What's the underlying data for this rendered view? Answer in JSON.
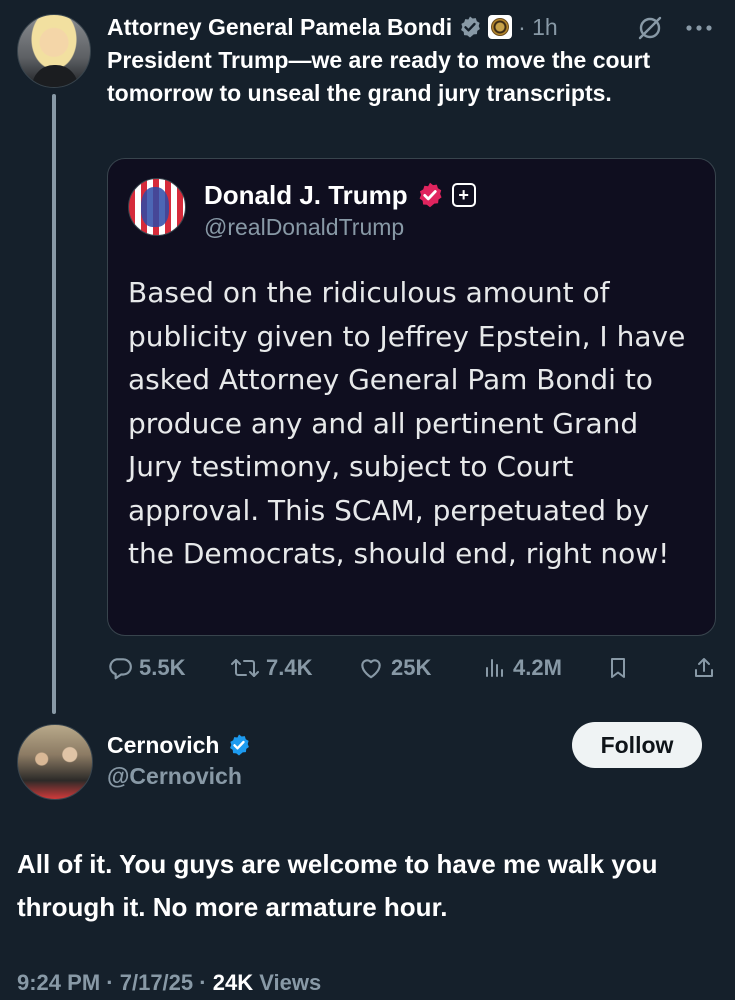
{
  "parent_tweet": {
    "author_name": "Attorney General Pamela Bondi",
    "time": "· 1h",
    "text": "President Trump—we are ready to move the court tomorrow to unseal the grand jury transcripts.",
    "quote": {
      "author_name": "Donald J. Trump",
      "handle": "@realDonaldTrump",
      "text": "Based on the ridiculous amount of publicity given to Jeffrey Epstein, I have asked Attorney General Pam Bondi to produce any and all pertinent Grand Jury testimony, subject to Court approval. This SCAM, perpetuated by the Democrats, should end, right now!"
    },
    "actions": {
      "replies": "5.5K",
      "reposts": "7.4K",
      "likes": "25K",
      "views": "4.2M"
    }
  },
  "reply_tweet": {
    "author_name": "Cernovich",
    "handle": "@Cernovich",
    "follow_label": "Follow",
    "text": "All of it. You guys are welcome to have me walk you through it. No more armature hour.",
    "footer": {
      "time": "9:24 PM",
      "date": "7/17/25",
      "views_count": "24K",
      "views_label": "Views"
    }
  },
  "icons": {
    "gray_check": "gray-verified-badge-icon",
    "gov_seal": "doj-seal-icon",
    "grok": "grok-icon",
    "more": "more-icon",
    "pink_check": "pink-verified-badge-icon",
    "subscribe": "plus-icon",
    "reply": "reply-icon",
    "repost": "repost-icon",
    "like": "heart-icon",
    "views": "views-icon",
    "bookmark": "bookmark-icon",
    "share": "share-icon",
    "blue_check": "blue-verified-badge-icon"
  },
  "colors": {
    "background": "#15202b",
    "quote_background": "#0f0e1f",
    "secondary_text": "#8899a6",
    "blue_check": "#1d9bf0",
    "pink_check": "#e0245e"
  }
}
